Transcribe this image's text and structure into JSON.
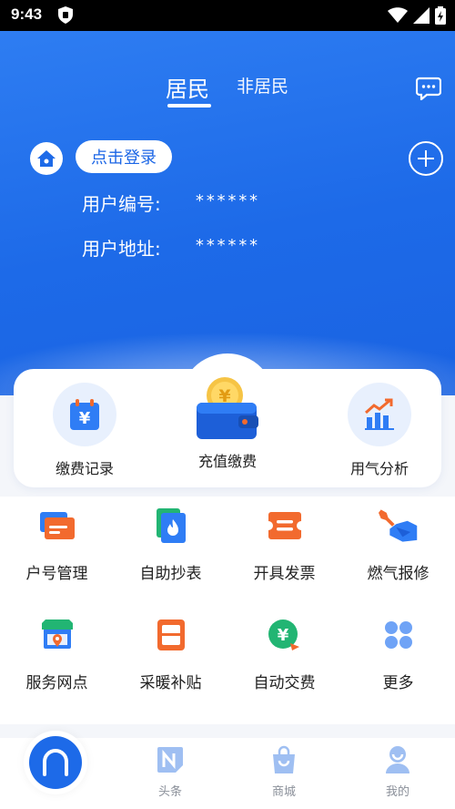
{
  "status_bar": {
    "time": "9:43"
  },
  "header": {
    "tabs": [
      {
        "label": "居民",
        "active": true
      },
      {
        "label": "非居民",
        "active": false
      }
    ]
  },
  "account": {
    "login_label": "点击登录",
    "user_id_label": "用户编号:",
    "user_id_value": "******",
    "user_address_label": "用户地址:",
    "user_address_value": "******"
  },
  "quick_card": {
    "items": [
      {
        "label": "缴费记录",
        "icon": "payment-records-icon"
      },
      {
        "label": "充值缴费",
        "icon": "wallet-recharge-icon"
      },
      {
        "label": "用气分析",
        "icon": "gas-analysis-chart-icon"
      }
    ]
  },
  "services": [
    {
      "label": "户号管理",
      "icon": "account-card-icon"
    },
    {
      "label": "自助抄表",
      "icon": "meter-reading-icon"
    },
    {
      "label": "开具发票",
      "icon": "invoice-icon"
    },
    {
      "label": "燃气报修",
      "icon": "repair-wrench-icon"
    },
    {
      "label": "服务网点",
      "icon": "service-outlet-icon"
    },
    {
      "label": "采暖补贴",
      "icon": "heating-subsidy-icon"
    },
    {
      "label": "自动交费",
      "icon": "auto-pay-icon"
    },
    {
      "label": "更多",
      "icon": "more-grid-icon"
    }
  ],
  "bottom_nav": [
    {
      "label": "",
      "icon": "home-icon",
      "active": true
    },
    {
      "label": "头条",
      "icon": "news-icon"
    },
    {
      "label": "商城",
      "icon": "shop-bag-icon"
    },
    {
      "label": "我的",
      "icon": "profile-icon"
    }
  ],
  "colors": {
    "primary": "#1d6ae8",
    "accent_orange": "#f26a2e",
    "icon_light_bg": "#e8f0fd",
    "nav_inactive": "#8a8f99"
  }
}
